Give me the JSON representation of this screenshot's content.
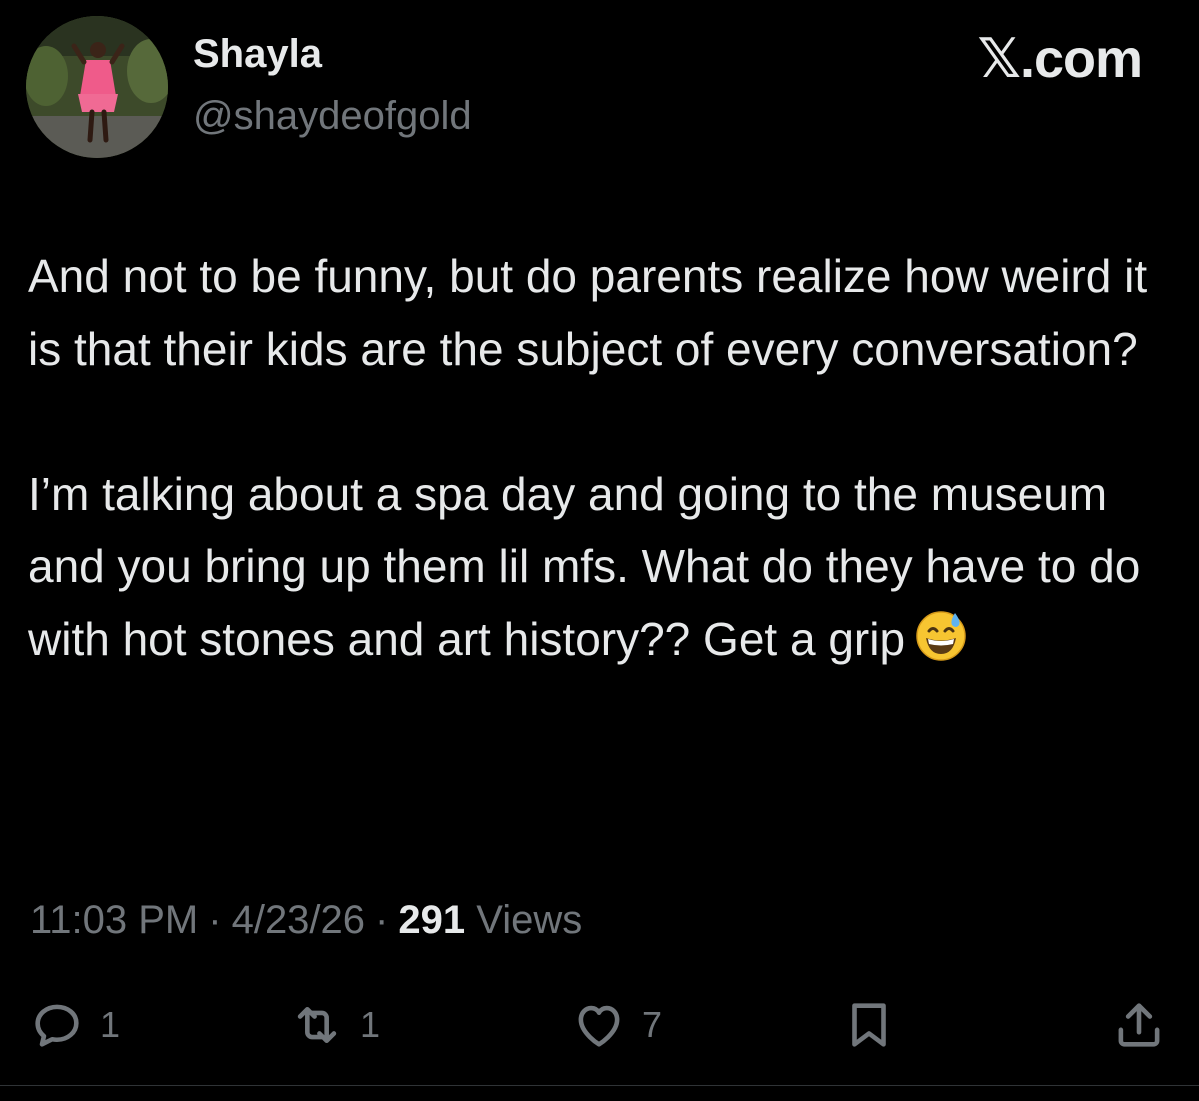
{
  "author": {
    "display_name": "Shayla",
    "handle": "@shaydeofgold"
  },
  "brand": "𝕏.com",
  "tweet": {
    "paragraphs": [
      "And not to be funny, but do parents realize how weird it is that their kids are the subject of every conversation?",
      "I’m talking about a spa day and going to the museum and you bring up them lil mfs. What do they have to do with hot stones and art history?? Get a grip"
    ],
    "emoji": "grinning-face-with-sweat"
  },
  "meta": {
    "time": "11:03 PM",
    "separator": "·",
    "date": "4/23/26",
    "views_count": "291",
    "views_label": "Views"
  },
  "actions": {
    "reply_count": "1",
    "repost_count": "1",
    "like_count": "7",
    "icons": [
      "reply-icon",
      "repost-icon",
      "like-icon",
      "bookmark-icon",
      "share-icon"
    ]
  },
  "colors": {
    "background": "#000000",
    "primary_text": "#e7e9ea",
    "secondary_text": "#71767b"
  }
}
